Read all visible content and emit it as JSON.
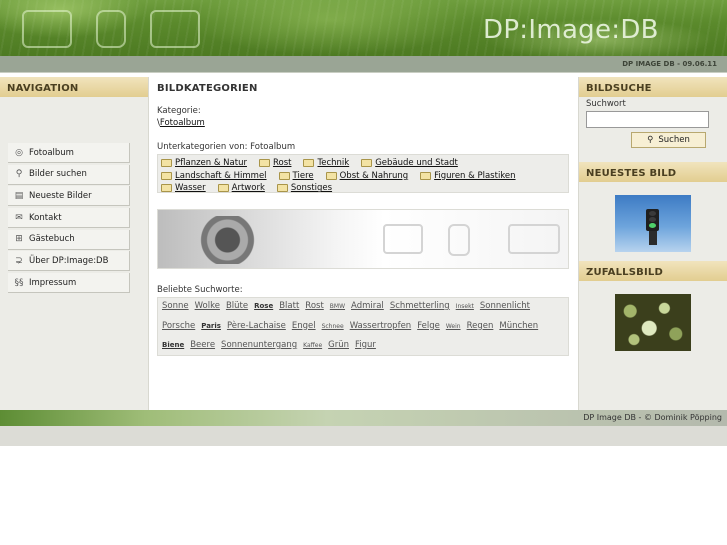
{
  "header": {
    "app_title": "DP:Image:DB",
    "version_text": "DP IMAGE DB - 09.06.11"
  },
  "navigation": {
    "title": "NAVIGATION",
    "items": [
      {
        "label": "Fotoalbum",
        "icon": "photo-album-icon",
        "glyph": "◎"
      },
      {
        "label": "Bilder suchen",
        "icon": "search-icon",
        "glyph": "⚲"
      },
      {
        "label": "Neueste Bilder",
        "icon": "newest-images-icon",
        "glyph": "▤"
      },
      {
        "label": "Kontakt",
        "icon": "mail-icon",
        "glyph": "✉"
      },
      {
        "label": "Gästebuch",
        "icon": "guestbook-icon",
        "glyph": "⊞"
      },
      {
        "label": "Über DP:Image:DB",
        "icon": "info-icon",
        "glyph": "⊋"
      },
      {
        "label": "Impressum",
        "icon": "paragraph-icon",
        "glyph": "§§"
      }
    ]
  },
  "main": {
    "title": "BILDKATEGORIEN",
    "category_label": "Kategorie:",
    "category_link_prefix": "\\",
    "category_link": "Fotoalbum",
    "subcategories_label": "Unterkategorien von: Fotoalbum",
    "subcategory_rows": [
      [
        "Pflanzen & Natur",
        "Rost",
        "Technik",
        "Gebäude und Stadt"
      ],
      [
        "Landschaft & Himmel",
        "Tiere",
        "Obst & Nahrung",
        "Figuren & Plastiken"
      ],
      [
        "Wasser",
        "Artwork",
        "Sonstiges"
      ]
    ],
    "popular_label": "Beliebte Suchworte:",
    "tag_rows": [
      [
        {
          "t": "Sonne",
          "s": "m"
        },
        {
          "t": "Wolke",
          "s": "m"
        },
        {
          "t": "Blüte",
          "s": "m"
        },
        {
          "t": "Rose",
          "s": "b"
        },
        {
          "t": "Blatt",
          "s": "m"
        },
        {
          "t": "Rost",
          "s": "m"
        },
        {
          "t": "BMW",
          "s": "s"
        },
        {
          "t": "Admiral",
          "s": "m"
        },
        {
          "t": "Schmetterling",
          "s": "m"
        },
        {
          "t": "Insekt",
          "s": "s"
        },
        {
          "t": "Sonnenlicht",
          "s": "m"
        }
      ],
      [
        {
          "t": "Porsche",
          "s": "m"
        },
        {
          "t": "Paris",
          "s": "b"
        },
        {
          "t": "Père-Lachaise",
          "s": "m"
        },
        {
          "t": "Engel",
          "s": "m"
        },
        {
          "t": "Schnee",
          "s": "s"
        },
        {
          "t": "Wassertropfen",
          "s": "m"
        },
        {
          "t": "Felge",
          "s": "m"
        },
        {
          "t": "Wein",
          "s": "s"
        },
        {
          "t": "Regen",
          "s": "m"
        },
        {
          "t": "München",
          "s": "m"
        }
      ],
      [
        {
          "t": "Biene",
          "s": "b"
        },
        {
          "t": "Beere",
          "s": "m"
        },
        {
          "t": "Sonnenuntergang",
          "s": "m"
        },
        {
          "t": "Kaffee",
          "s": "s"
        },
        {
          "t": "Grün",
          "s": "m"
        },
        {
          "t": "Figur",
          "s": "m"
        }
      ]
    ]
  },
  "sidebar": {
    "search_title": "BILDSUCHE",
    "search_label": "Suchwort",
    "search_value": "",
    "search_button": "Suchen",
    "newest_title": "NEUESTES BILD",
    "random_title": "ZUFALLSBILD"
  },
  "footer": {
    "copyright": "DP Image DB - © Dominik Pöpping"
  }
}
